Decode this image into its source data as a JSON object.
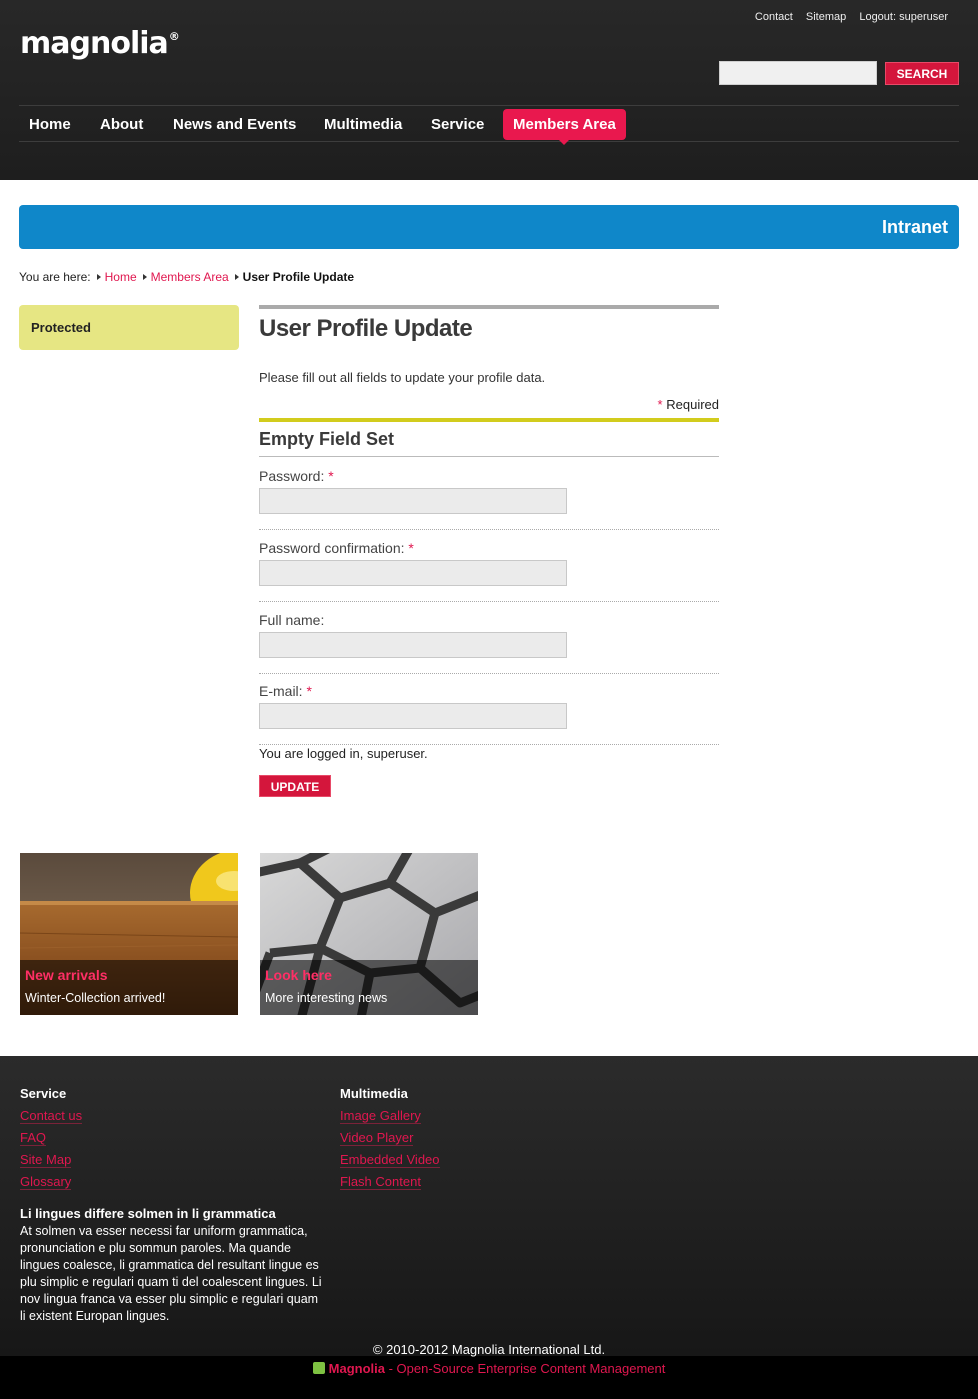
{
  "header": {
    "logo": "magnolia",
    "logo_mark": "®",
    "meta_links": [
      "Contact",
      "Sitemap",
      "Logout: superuser"
    ],
    "search_placeholder": "",
    "search_button": "SEARCH"
  },
  "nav": {
    "items": [
      "Home",
      "About",
      "News and Events",
      "Multimedia",
      "Service",
      "Members Area"
    ],
    "active": "Members Area"
  },
  "intranet": {
    "title": "Intranet"
  },
  "breadcrumb": {
    "prefix": "You are here:",
    "links": [
      "Home",
      "Members Area"
    ],
    "current": "User Profile Update"
  },
  "sidebar": {
    "protected_label": "Protected"
  },
  "form": {
    "title": "User Profile Update",
    "intro": "Please fill out all fields to update your profile data.",
    "required_star": "*",
    "required_label": "Required",
    "fieldset_title": "Empty Field Set",
    "fields": [
      {
        "label": "Password:",
        "required": true,
        "value": ""
      },
      {
        "label": "Password confirmation:",
        "required": true,
        "value": ""
      },
      {
        "label": "Full name:",
        "required": false,
        "value": ""
      },
      {
        "label": "E-mail:",
        "required": true,
        "value": ""
      }
    ],
    "logged_in": "You are logged in, superuser.",
    "submit": "UPDATE"
  },
  "teasers": [
    {
      "title": "New arrivals",
      "text": "Winter-Collection arrived!"
    },
    {
      "title": "Look here",
      "text": "More interesting news"
    }
  ],
  "footer": {
    "service": {
      "heading": "Service",
      "links": [
        "Contact us",
        "FAQ",
        "Site Map",
        "Glossary"
      ]
    },
    "multimedia": {
      "heading": "Multimedia",
      "links": [
        "Image Gallery",
        "Video Player",
        "Embedded Video",
        "Flash Content"
      ]
    },
    "about_title": "Li lingues differe solmen in li grammatica",
    "about_text": "At solmen va esser necessi far uniform grammatica, pronunciation e plu sommun paroles. Ma quande lingues coalesce, li grammatica del resultant lingue es plu simplic e regulari quam ti del coalescent lingues. Li nov lingua franca va esser plu simplic e regulari quam li existent Europan lingues.",
    "copyright": "© 2010-2012 Magnolia International Ltd.",
    "powered_brand": "Magnolia",
    "powered_text": " - Open-Source Enterprise Content Management"
  },
  "colors": {
    "accent": "#e9184e",
    "intranet_blue": "#0f87c9",
    "protected_yellow": "#e6e683",
    "fieldset_rule": "#d2cc1d"
  }
}
